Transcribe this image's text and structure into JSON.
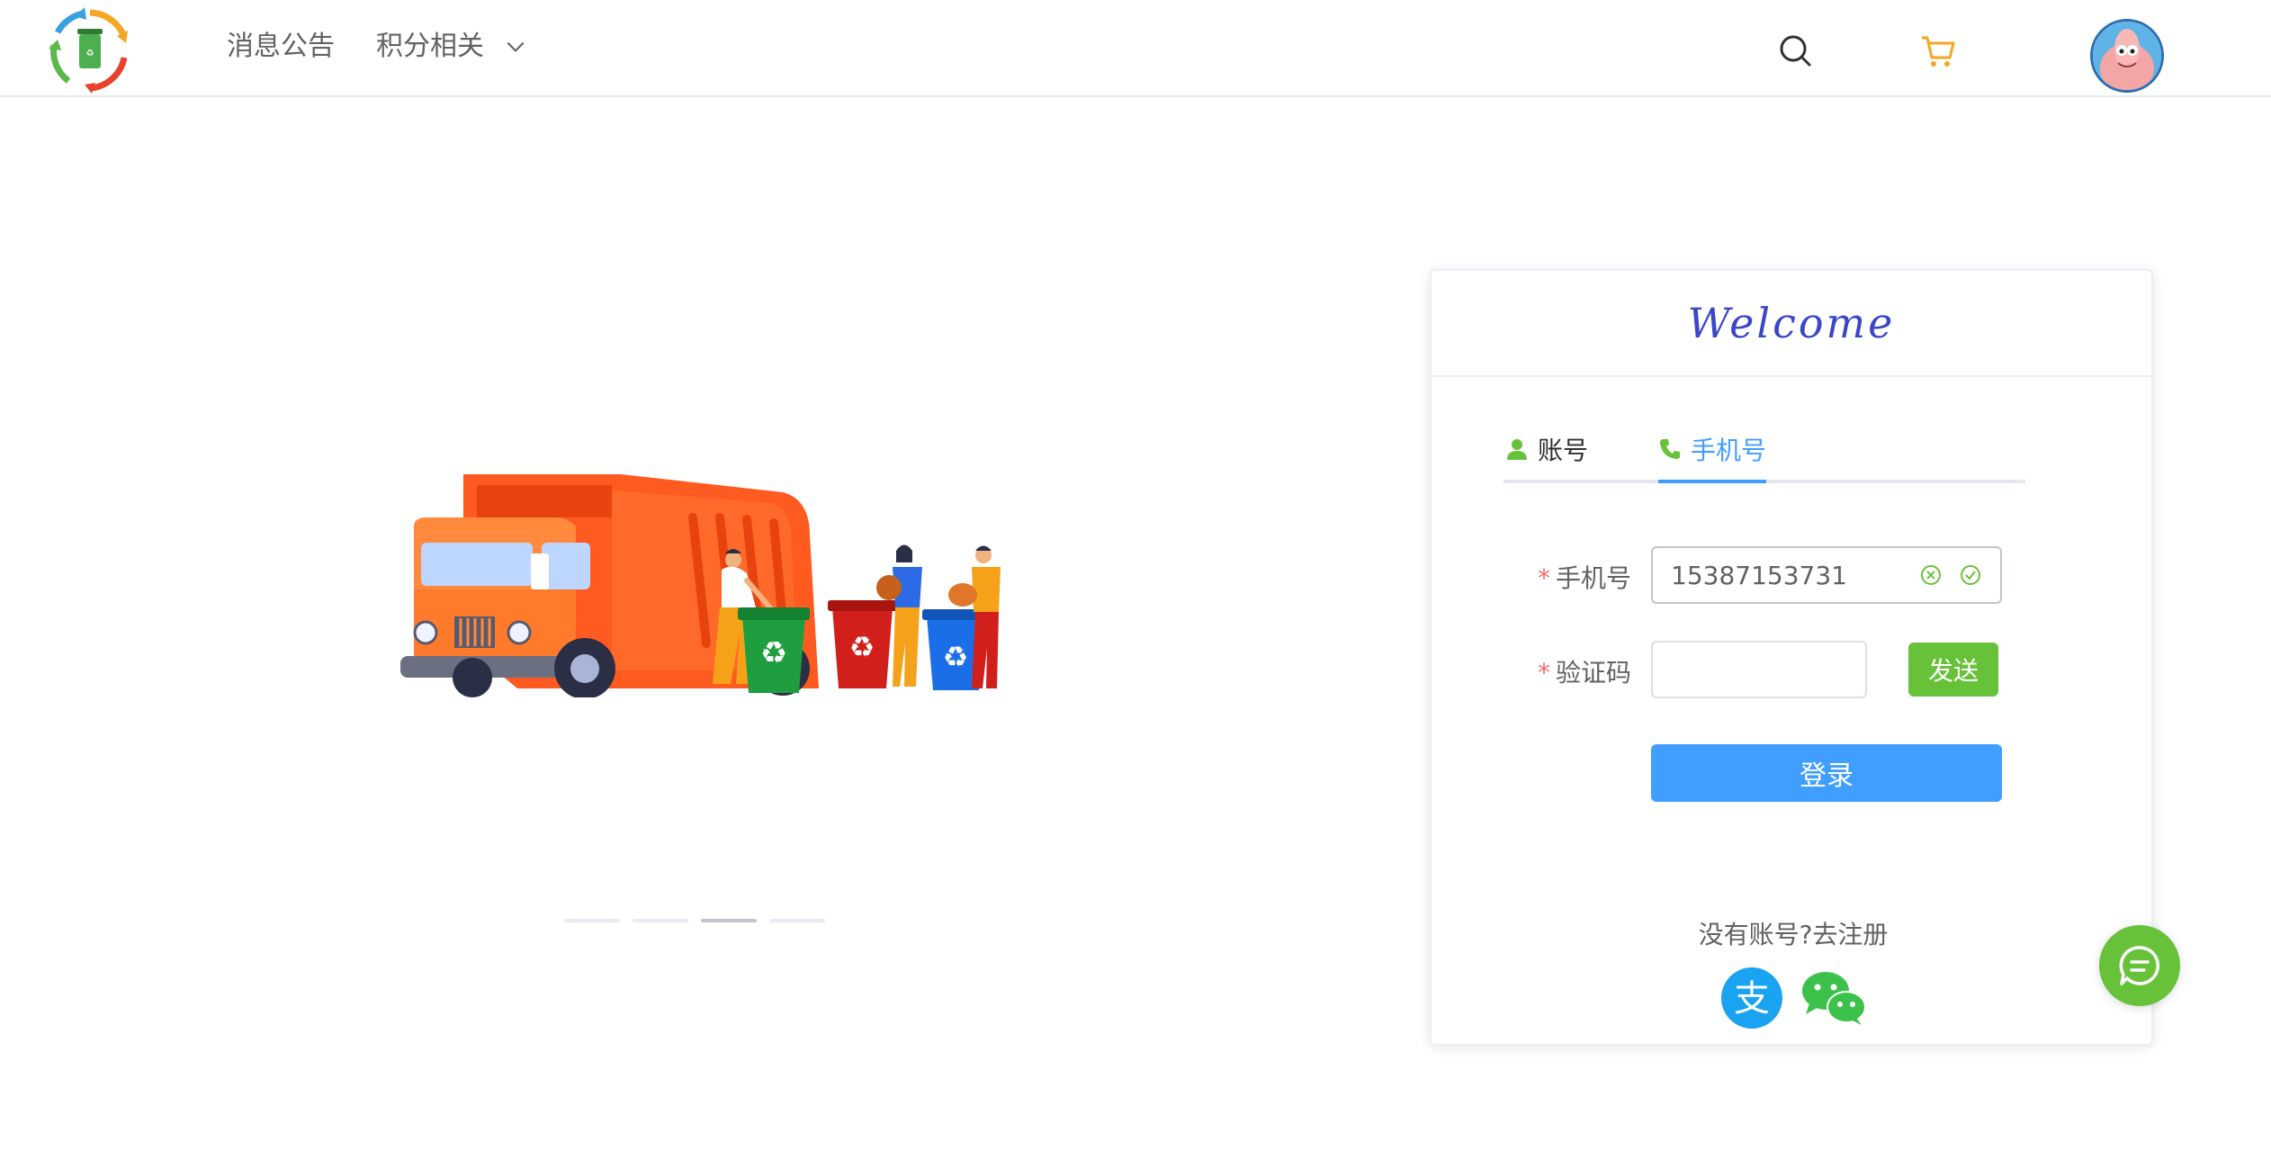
{
  "header": {
    "nav": [
      {
        "label": "消息公告"
      },
      {
        "label": "积分相关"
      }
    ]
  },
  "carousel": {
    "slide_count": 4,
    "active_index": 2
  },
  "login": {
    "title": "Welcome",
    "tabs": [
      {
        "label": "账号",
        "active": false
      },
      {
        "label": "手机号",
        "active": true
      }
    ],
    "phone_label": "手机号",
    "phone_value": "15387153731",
    "code_label": "验证码",
    "code_value": "",
    "required_mark": "*",
    "send_label": "发送",
    "login_label": "登录",
    "register_text": "没有账号?去注册"
  },
  "colors": {
    "primary": "#409eff",
    "success": "#67c23a",
    "title": "#3b46c9",
    "truck": "#ff5a1f"
  },
  "icons": [
    "logo-icon",
    "search-icon",
    "cart-icon",
    "user-icon",
    "phone-icon",
    "clear-icon",
    "check-icon",
    "alipay-icon",
    "wechat-icon",
    "chat-icon"
  ]
}
